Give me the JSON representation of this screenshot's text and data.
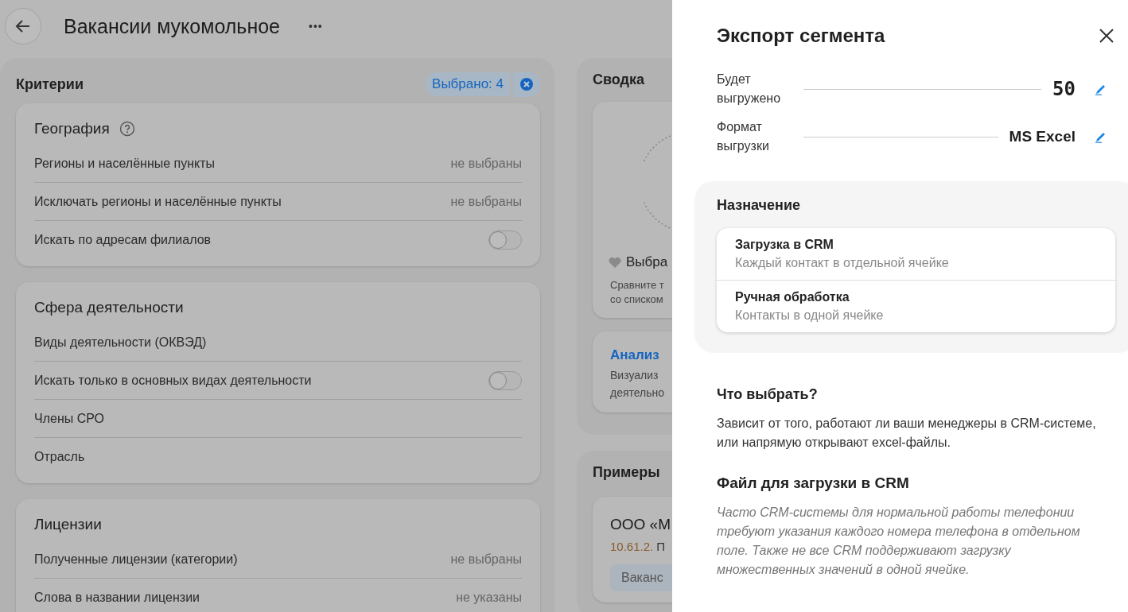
{
  "header": {
    "title": "Вакансии мукомольное",
    "more": "•••"
  },
  "criteria": {
    "title": "Критерии",
    "selected_badge": "Выбрано: 4",
    "groups": [
      {
        "title": "География",
        "help": true,
        "rows": [
          {
            "kind": "value",
            "label": "Регионы и населённые пункты",
            "value": "не выбраны"
          },
          {
            "kind": "value",
            "label": "Исключать регионы и населённые пункты",
            "value": "не выбраны"
          },
          {
            "kind": "toggle",
            "label": "Искать по адресам филиалов",
            "on": false
          }
        ]
      },
      {
        "title": "Сфера деятельности",
        "help": false,
        "rows": [
          {
            "kind": "plain",
            "label": "Виды деятельности (ОКВЭД)"
          },
          {
            "kind": "toggle",
            "label": "Искать только в основных видах деятельности",
            "on": false
          },
          {
            "kind": "plain",
            "label": "Члены СРО"
          },
          {
            "kind": "plain",
            "label": "Отрасль"
          }
        ]
      },
      {
        "title": "Лицензии",
        "help": false,
        "rows": [
          {
            "kind": "value",
            "label": "Полученные лицензии (категории)",
            "value": "не выбраны"
          },
          {
            "kind": "value",
            "label": "Слова в названии лицензии",
            "value": "не указаны"
          }
        ]
      }
    ]
  },
  "summary": {
    "title": "Сводка",
    "favorite": "Выбра",
    "compare_lines": [
      "Сравните т",
      "со списком"
    ],
    "analysis_title": "Анализ",
    "analysis_lines": [
      "Визуализ",
      "деятельно"
    ]
  },
  "examples": {
    "title": "Примеры",
    "company": "ООО «М",
    "code": "10.61.2.",
    "code_rest": "П",
    "chip": "Ваканс"
  },
  "drawer": {
    "title": "Экспорт сегмента",
    "fields": [
      {
        "label": "Будет выгружено",
        "value": "50",
        "kind": "number"
      },
      {
        "label": "Формат выгрузки",
        "value": "MS Excel",
        "kind": "text"
      }
    ],
    "purpose": {
      "title": "Назначение",
      "options": [
        {
          "title": "Загрузка в CRM",
          "subtitle": "Каждый контакт в отдельной ячейке"
        },
        {
          "title": "Ручная обработка",
          "subtitle": "Контакты в одной ячейке"
        }
      ]
    },
    "help_title": "Что выбрать?",
    "help_text": "Зависит от того, работают ли ваши менеджеры в CRM-системе, или напрямую открывают excel-файлы.",
    "crm_title": "Файл для загрузки в CRM",
    "crm_text": "Часто CRM-системы для нормальной работы телефонии требуют указания каждого номера телефона в отдельном поле. Также не все CRM поддерживают загрузку множественных значений в одной ячейке."
  }
}
